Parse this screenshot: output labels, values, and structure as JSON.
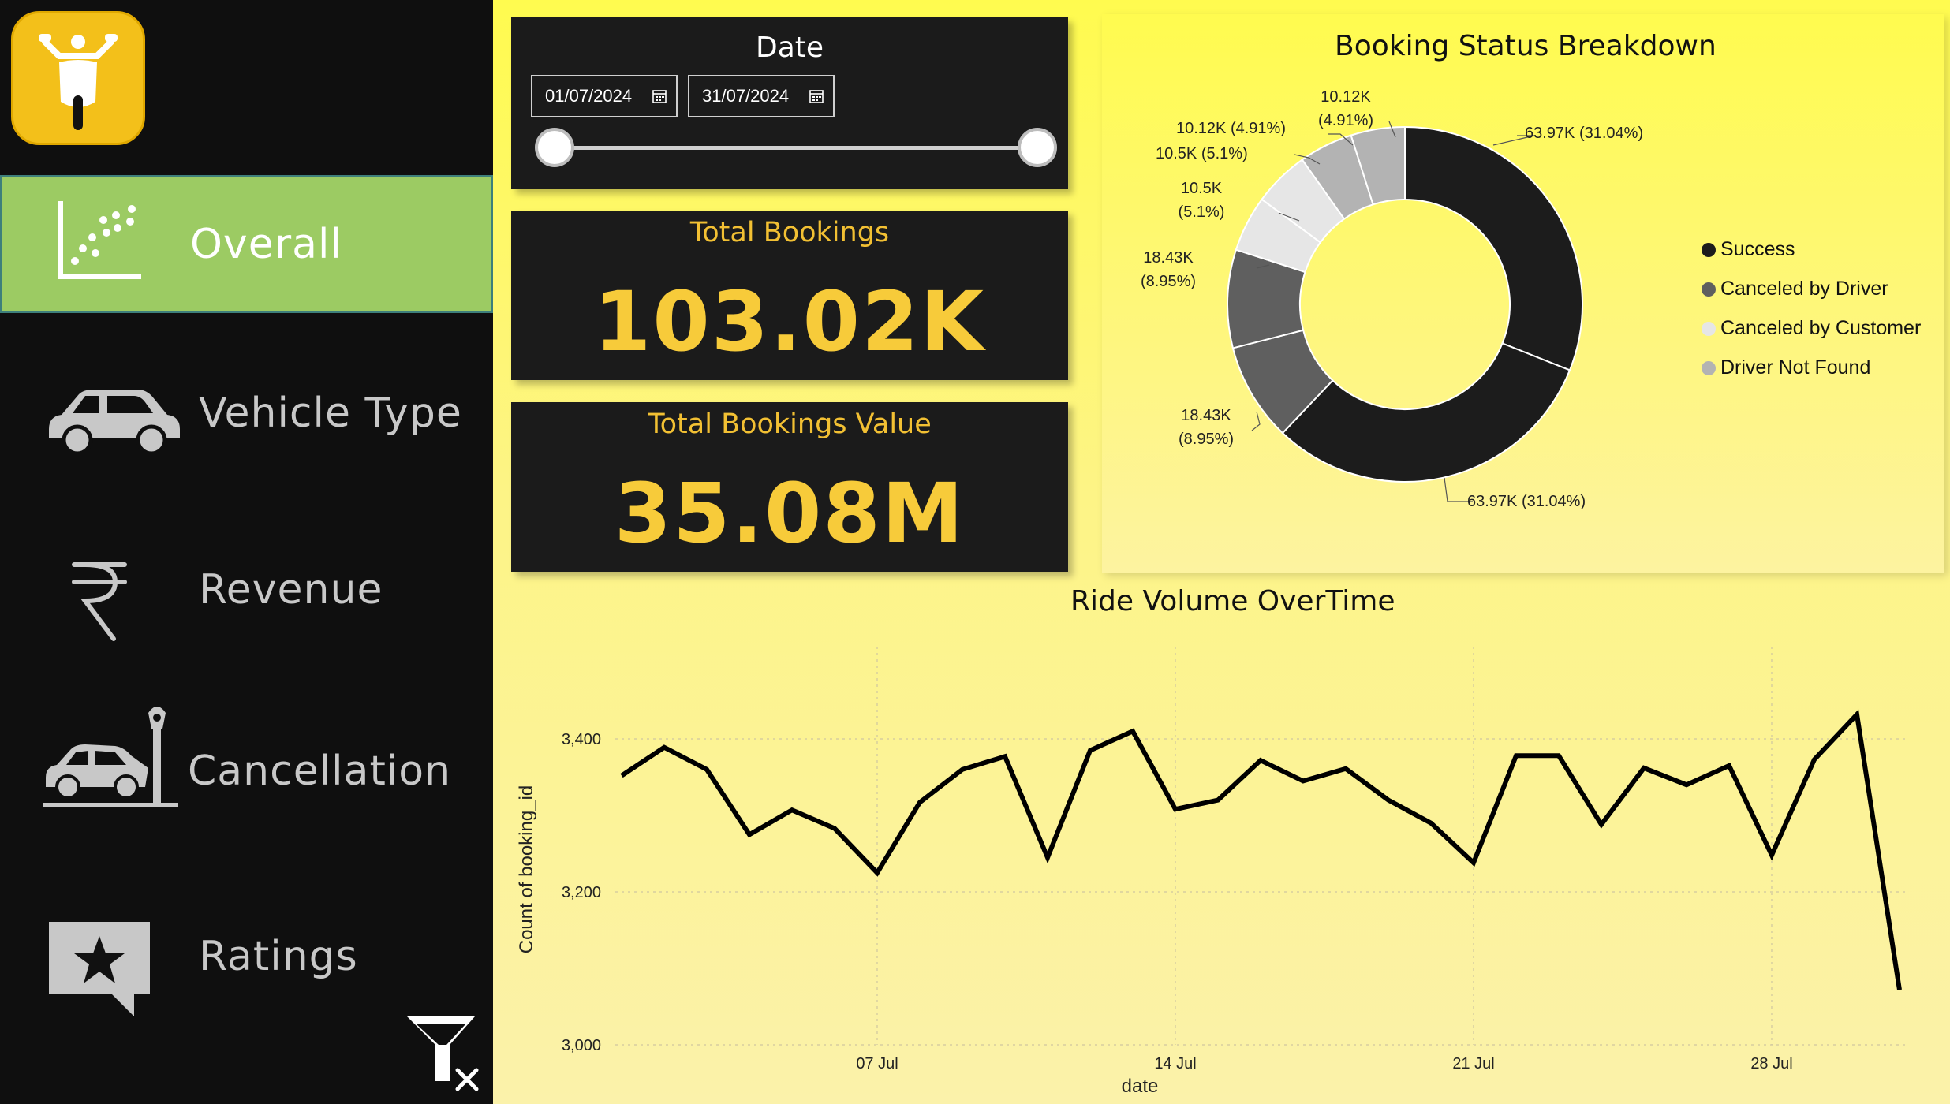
{
  "sidebar": {
    "logo_icon": "scooter-icon",
    "items": [
      {
        "label": "Overall",
        "icon": "scatter-chart-icon",
        "active": true
      },
      {
        "label": "Vehicle Type",
        "icon": "car-icon",
        "active": false
      },
      {
        "label": "Revenue",
        "icon": "rupee-icon",
        "active": false
      },
      {
        "label": "Cancellation",
        "icon": "car-crash-icon",
        "active": false
      },
      {
        "label": "Ratings",
        "icon": "star-bubble-icon",
        "active": false
      }
    ],
    "filter_icon": "clear-filter-icon"
  },
  "date_filter": {
    "title": "Date",
    "start": "01/07/2024",
    "end": "31/07/2024",
    "calendar_icon": "calendar-icon"
  },
  "kpis": {
    "total_bookings": {
      "title": "Total Bookings",
      "value": "103.02K"
    },
    "total_value": {
      "title": "Total Bookings Value",
      "value": "35.08M"
    }
  },
  "donut": {
    "title": "Booking Status Breakdown",
    "legend": [
      {
        "label": "Success",
        "color": "#1c1c1c"
      },
      {
        "label": "Canceled by Driver",
        "color": "#5f5f5f"
      },
      {
        "label": "Canceled by Customer",
        "color": "#e6e6e6"
      },
      {
        "label": "Driver Not Found",
        "color": "#b3b3b3"
      }
    ],
    "labels": {
      "success_top": "63.97K (31.04%)",
      "success_bottom": "63.97K (31.04%)",
      "driver_a_1": "18.43K",
      "driver_a_2": "(8.95%)",
      "driver_b_1": "18.43K",
      "driver_b_2": "(8.95%)",
      "cust_a_1": "10.5K",
      "cust_a_2": "(5.1%)",
      "cust_b": "10.5K (5.1%)",
      "dnf_a": "10.12K (4.91%)",
      "dnf_b_1": "10.12K",
      "dnf_b_2": "(4.91%)"
    }
  },
  "chart_data": [
    {
      "type": "pie",
      "title": "Booking Status Breakdown",
      "slices": [
        {
          "label": "Success",
          "value": 63970,
          "percent": 31.04,
          "color": "#1c1c1c"
        },
        {
          "label": "Success",
          "value": 63970,
          "percent": 31.04,
          "color": "#1c1c1c"
        },
        {
          "label": "Canceled by Driver",
          "value": 18430,
          "percent": 8.95,
          "color": "#5f5f5f"
        },
        {
          "label": "Canceled by Driver",
          "value": 18430,
          "percent": 8.95,
          "color": "#5f5f5f"
        },
        {
          "label": "Canceled by Customer",
          "value": 10500,
          "percent": 5.1,
          "color": "#e6e6e6"
        },
        {
          "label": "Canceled by Customer",
          "value": 10500,
          "percent": 5.1,
          "color": "#e6e6e6"
        },
        {
          "label": "Driver Not Found",
          "value": 10120,
          "percent": 4.91,
          "color": "#b3b3b3"
        },
        {
          "label": "Driver Not Found",
          "value": 10120,
          "percent": 4.91,
          "color": "#b3b3b3"
        }
      ],
      "legend_position": "right"
    },
    {
      "type": "line",
      "title": "Ride Volume OverTime",
      "xlabel": "date",
      "ylabel": "Count of booking_id",
      "x": [
        "2024-07-01",
        "2024-07-02",
        "2024-07-03",
        "2024-07-04",
        "2024-07-05",
        "2024-07-06",
        "2024-07-07",
        "2024-07-08",
        "2024-07-09",
        "2024-07-10",
        "2024-07-11",
        "2024-07-12",
        "2024-07-13",
        "2024-07-14",
        "2024-07-15",
        "2024-07-16",
        "2024-07-17",
        "2024-07-18",
        "2024-07-19",
        "2024-07-20",
        "2024-07-21",
        "2024-07-22",
        "2024-07-23",
        "2024-07-24",
        "2024-07-25",
        "2024-07-26",
        "2024-07-27",
        "2024-07-28",
        "2024-07-29",
        "2024-07-30",
        "2024-07-31"
      ],
      "series": [
        {
          "values": [
            3352,
            3389,
            3360,
            3275,
            3307,
            3283,
            3225,
            3317,
            3360,
            3377,
            3245,
            3385,
            3410,
            3308,
            3320,
            3372,
            3345,
            3361,
            3320,
            3290,
            3238,
            3378,
            3378,
            3288,
            3362,
            3340,
            3365,
            3248,
            3373,
            3432,
            3072
          ]
        }
      ],
      "x_ticks": [
        {
          "x": "2024-07-07",
          "label": "07 Jul"
        },
        {
          "x": "2024-07-14",
          "label": "14 Jul"
        },
        {
          "x": "2024-07-21",
          "label": "21 Jul"
        },
        {
          "x": "2024-07-28",
          "label": "28 Jul"
        }
      ],
      "y_ticks": [
        {
          "value": 3000,
          "label": "3,000"
        },
        {
          "value": 3200,
          "label": "3,200"
        },
        {
          "value": 3400,
          "label": "3,400"
        }
      ],
      "ylim": [
        3000,
        3500
      ],
      "grid": true,
      "line_color": "#000000"
    }
  ]
}
